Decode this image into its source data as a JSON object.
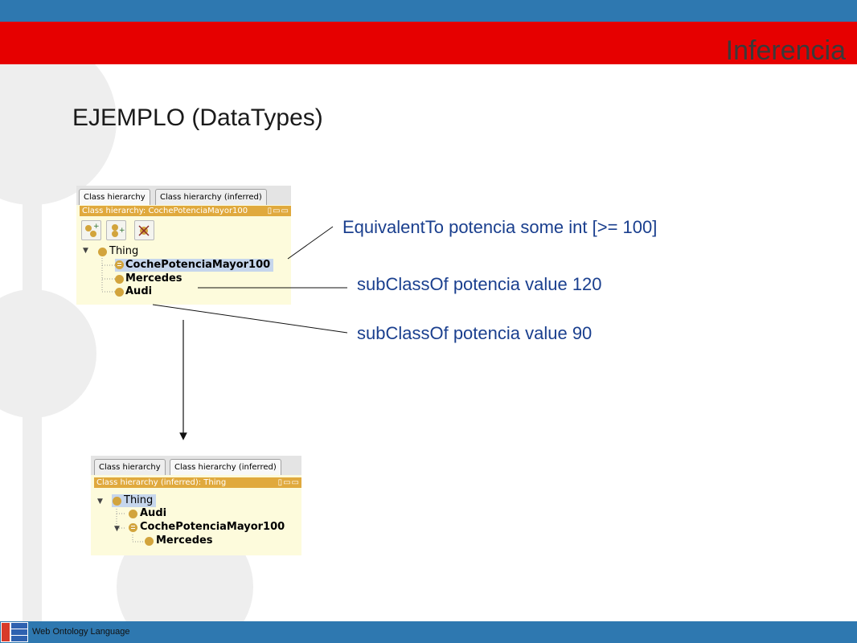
{
  "slide": {
    "title": "Inferencia",
    "heading": "EJEMPLO (DataTypes)",
    "footer_text": "Web Ontology Language"
  },
  "panel_asserted": {
    "tabs": [
      {
        "label": "Class hierarchy",
        "active": true
      },
      {
        "label": "Class hierarchy (inferred)",
        "active": false
      }
    ],
    "titlebar": "Class hierarchy: CochePotenciaMayor100",
    "toolbar": [
      "add-subclass-icon",
      "add-sibling-icon",
      "delete-class-icon"
    ],
    "tree": [
      {
        "label": "Thing",
        "expanded": true
      },
      {
        "label": "CochePotenciaMayor100",
        "equivalent": true,
        "selected": true
      },
      {
        "label": "Mercedes"
      },
      {
        "label": "Audi"
      }
    ]
  },
  "panel_inferred": {
    "tabs": [
      {
        "label": "Class hierarchy",
        "active": false
      },
      {
        "label": "Class hierarchy (inferred)",
        "active": true
      }
    ],
    "titlebar": "Class hierarchy (inferred): Thing",
    "tree": [
      {
        "label": "Thing",
        "expanded": true,
        "selected": true
      },
      {
        "label": "Audi"
      },
      {
        "label": "CochePotenciaMayor100",
        "equivalent": true,
        "expanded": true
      },
      {
        "label": "Mercedes"
      }
    ]
  },
  "annotations": [
    {
      "text": "EquivalentTo potencia some int [>= 100]"
    },
    {
      "text": "subClassOf potencia value 120"
    },
    {
      "text": "subClassOf potencia value 90"
    }
  ],
  "colors": {
    "header_blue": "#2e78b0",
    "header_red": "#e60000",
    "annotation_blue": "#1a3f8e",
    "panel_bg": "#fdfbdc",
    "titlebar_orange": "#e0a93d",
    "class_dot": "#d2a43c"
  }
}
